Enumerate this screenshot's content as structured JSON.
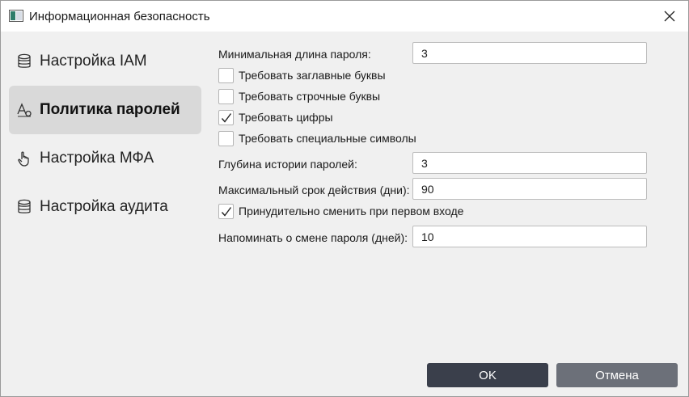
{
  "window": {
    "title": "Информационная безопасность"
  },
  "sidebar": {
    "items": [
      {
        "label": "Настройка IAM",
        "icon": "database-icon",
        "active": false
      },
      {
        "label": "Политика паролей",
        "icon": "font-text-icon",
        "active": true
      },
      {
        "label": "Настройка МФА",
        "icon": "hand-pointer-icon",
        "active": false
      },
      {
        "label": "Настройка аудита",
        "icon": "database-icon",
        "active": false
      }
    ]
  },
  "form": {
    "min_length": {
      "label": "Минимальная длина пароля:",
      "value": "3"
    },
    "require_upper": {
      "label": "Требовать заглавные буквы",
      "checked": false
    },
    "require_lower": {
      "label": "Требовать строчные буквы",
      "checked": false
    },
    "require_digits": {
      "label": "Требовать цифры",
      "checked": true
    },
    "require_special": {
      "label": "Требовать специальные символы",
      "checked": false
    },
    "history_depth": {
      "label": "Глубина истории паролей:",
      "value": "3"
    },
    "max_age": {
      "label": "Максимальный срок действия (дни):",
      "value": "90"
    },
    "force_change": {
      "label": "Принудительно сменить при первом входе",
      "checked": true
    },
    "remind_days": {
      "label": "Напоминать о смене пароля (дней):",
      "value": "10"
    }
  },
  "buttons": {
    "ok": "OK",
    "cancel": "Отмена"
  },
  "colors": {
    "ok_bg": "#3a3f4b",
    "cancel_bg": "#6c7079",
    "active_item_bg": "#d9d9d9"
  }
}
